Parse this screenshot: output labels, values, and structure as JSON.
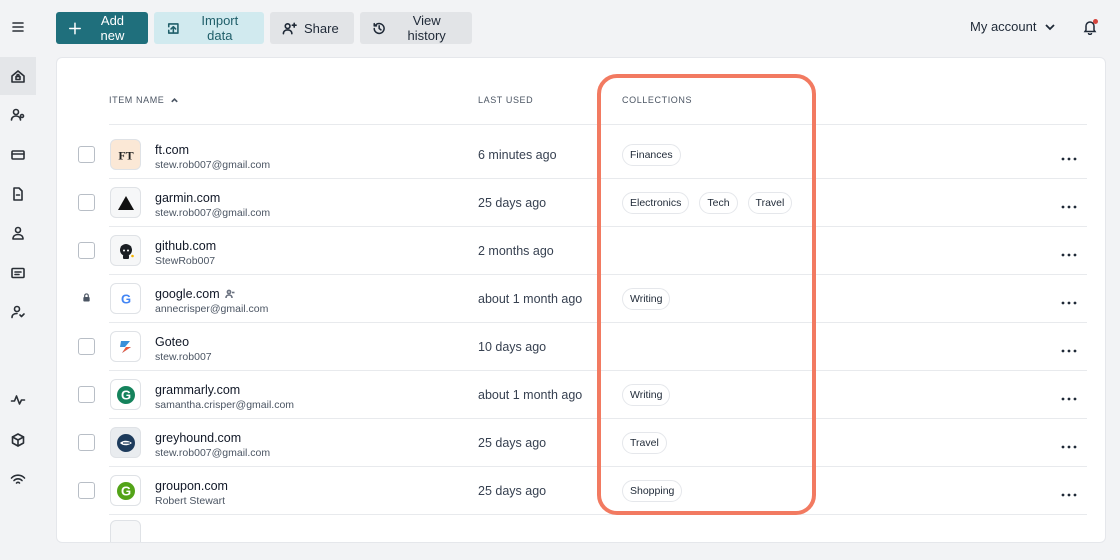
{
  "toolbar": {
    "add_new": "Add new",
    "import_data": "Import data",
    "share": "Share",
    "view_history": "View history"
  },
  "account": {
    "label": "My account"
  },
  "table": {
    "headers": {
      "item_name": "ITEM NAME",
      "last_used": "LAST USED",
      "collections": "COLLECTIONS"
    },
    "rows": [
      {
        "name": "ft.com",
        "user": "stew.rob007@gmail.com",
        "last_used": "6 minutes ago",
        "tags": [
          "Finances"
        ],
        "icon": "ft-logo-icon",
        "locked": false,
        "shared": false
      },
      {
        "name": "garmin.com",
        "user": "stew.rob007@gmail.com",
        "last_used": "25 days ago",
        "tags": [
          "Electronics",
          "Tech",
          "Travel"
        ],
        "icon": "garmin-logo-icon",
        "locked": false,
        "shared": false
      },
      {
        "name": "github.com",
        "user": "StewRob007",
        "last_used": "2 months ago",
        "tags": [],
        "icon": "github-logo-icon",
        "locked": false,
        "shared": false
      },
      {
        "name": "google.com",
        "user": "annecrisper@gmail.com",
        "last_used": "about 1 month ago",
        "tags": [
          "Writing"
        ],
        "icon": "google-logo-icon",
        "locked": true,
        "shared": true
      },
      {
        "name": "Goteo",
        "user": "stew.rob007",
        "last_used": "10 days ago",
        "tags": [],
        "icon": "goteo-logo-icon",
        "locked": false,
        "shared": false
      },
      {
        "name": "grammarly.com",
        "user": "samantha.crisper@gmail.com",
        "last_used": "about 1 month ago",
        "tags": [
          "Writing"
        ],
        "icon": "grammarly-logo-icon",
        "locked": false,
        "shared": false
      },
      {
        "name": "greyhound.com",
        "user": "stew.rob007@gmail.com",
        "last_used": "25 days ago",
        "tags": [
          "Travel"
        ],
        "icon": "greyhound-logo-icon",
        "locked": false,
        "shared": false
      },
      {
        "name": "groupon.com",
        "user": "Robert Stewart",
        "last_used": "25 days ago",
        "tags": [
          "Shopping"
        ],
        "icon": "groupon-logo-icon",
        "locked": false,
        "shared": false
      }
    ]
  },
  "colors": {
    "primary": "#1f6f7c",
    "accent_light": "#d1eaef",
    "highlight": "#f27a61",
    "notification": "#d6453d"
  }
}
